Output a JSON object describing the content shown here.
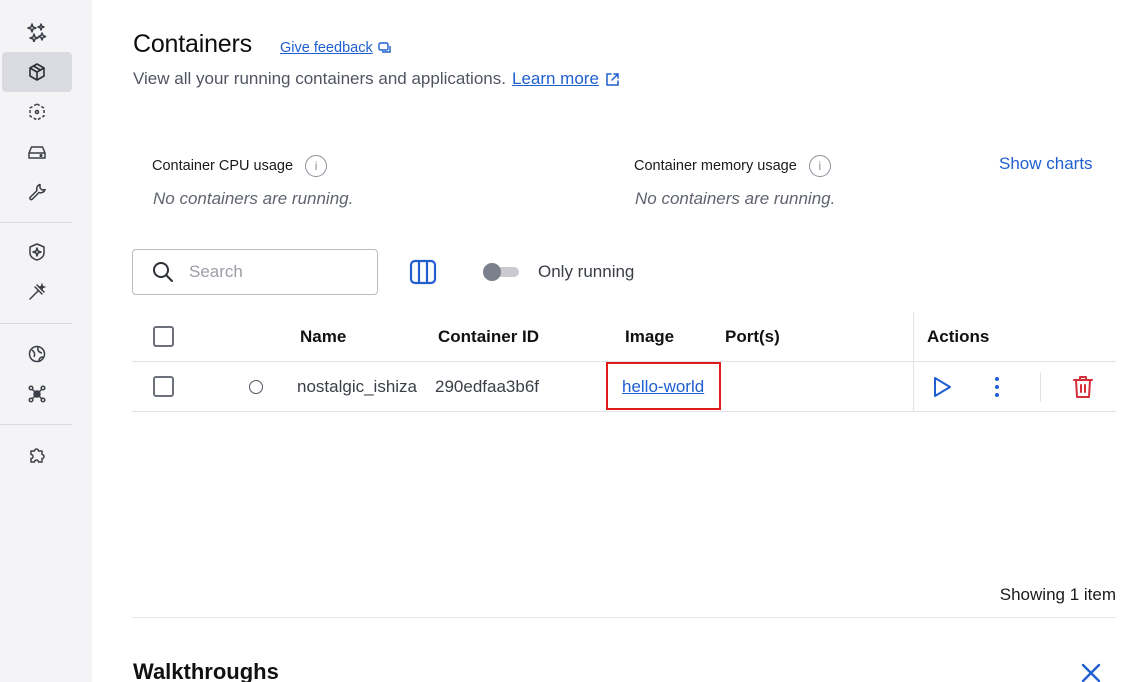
{
  "sidebar": {
    "items": [
      {
        "icon": "sparkles-icon"
      },
      {
        "icon": "containers-icon",
        "active": true
      },
      {
        "icon": "images-icon"
      },
      {
        "icon": "volumes-icon"
      },
      {
        "icon": "builds-icon"
      },
      {
        "icon": "docker-scout-icon"
      },
      {
        "icon": "models-icon"
      },
      {
        "icon": "extensions-marketplace-icon"
      },
      {
        "icon": "kubernetes-icon"
      },
      {
        "icon": "extensions-icon"
      }
    ]
  },
  "header": {
    "title": "Containers",
    "feedback_label": "Give feedback",
    "subtitle": "View all your running containers and applications.",
    "learn_more": "Learn more"
  },
  "stats": {
    "cpu_label": "Container CPU usage",
    "cpu_empty": "No containers are running.",
    "memory_label": "Container memory usage",
    "memory_empty": "No containers are running.",
    "info_glyph": "i",
    "show_charts": "Show charts"
  },
  "toolbar": {
    "search_placeholder": "Search",
    "only_running_label": "Only running",
    "only_running_on": false
  },
  "table": {
    "headers": {
      "name": "Name",
      "container_id": "Container ID",
      "image": "Image",
      "ports": "Port(s)",
      "actions": "Actions"
    },
    "rows": [
      {
        "name": "nostalgic_ishiza",
        "container_id": "290edfaa3b6f",
        "image": "hello-world",
        "ports": ""
      }
    ]
  },
  "footer": {
    "showing": "Showing 1 item",
    "walkthroughs": "Walkthroughs"
  },
  "colors": {
    "accent": "#1f5fd0",
    "danger": "#d62d3a",
    "highlight": "#e01b1b"
  }
}
